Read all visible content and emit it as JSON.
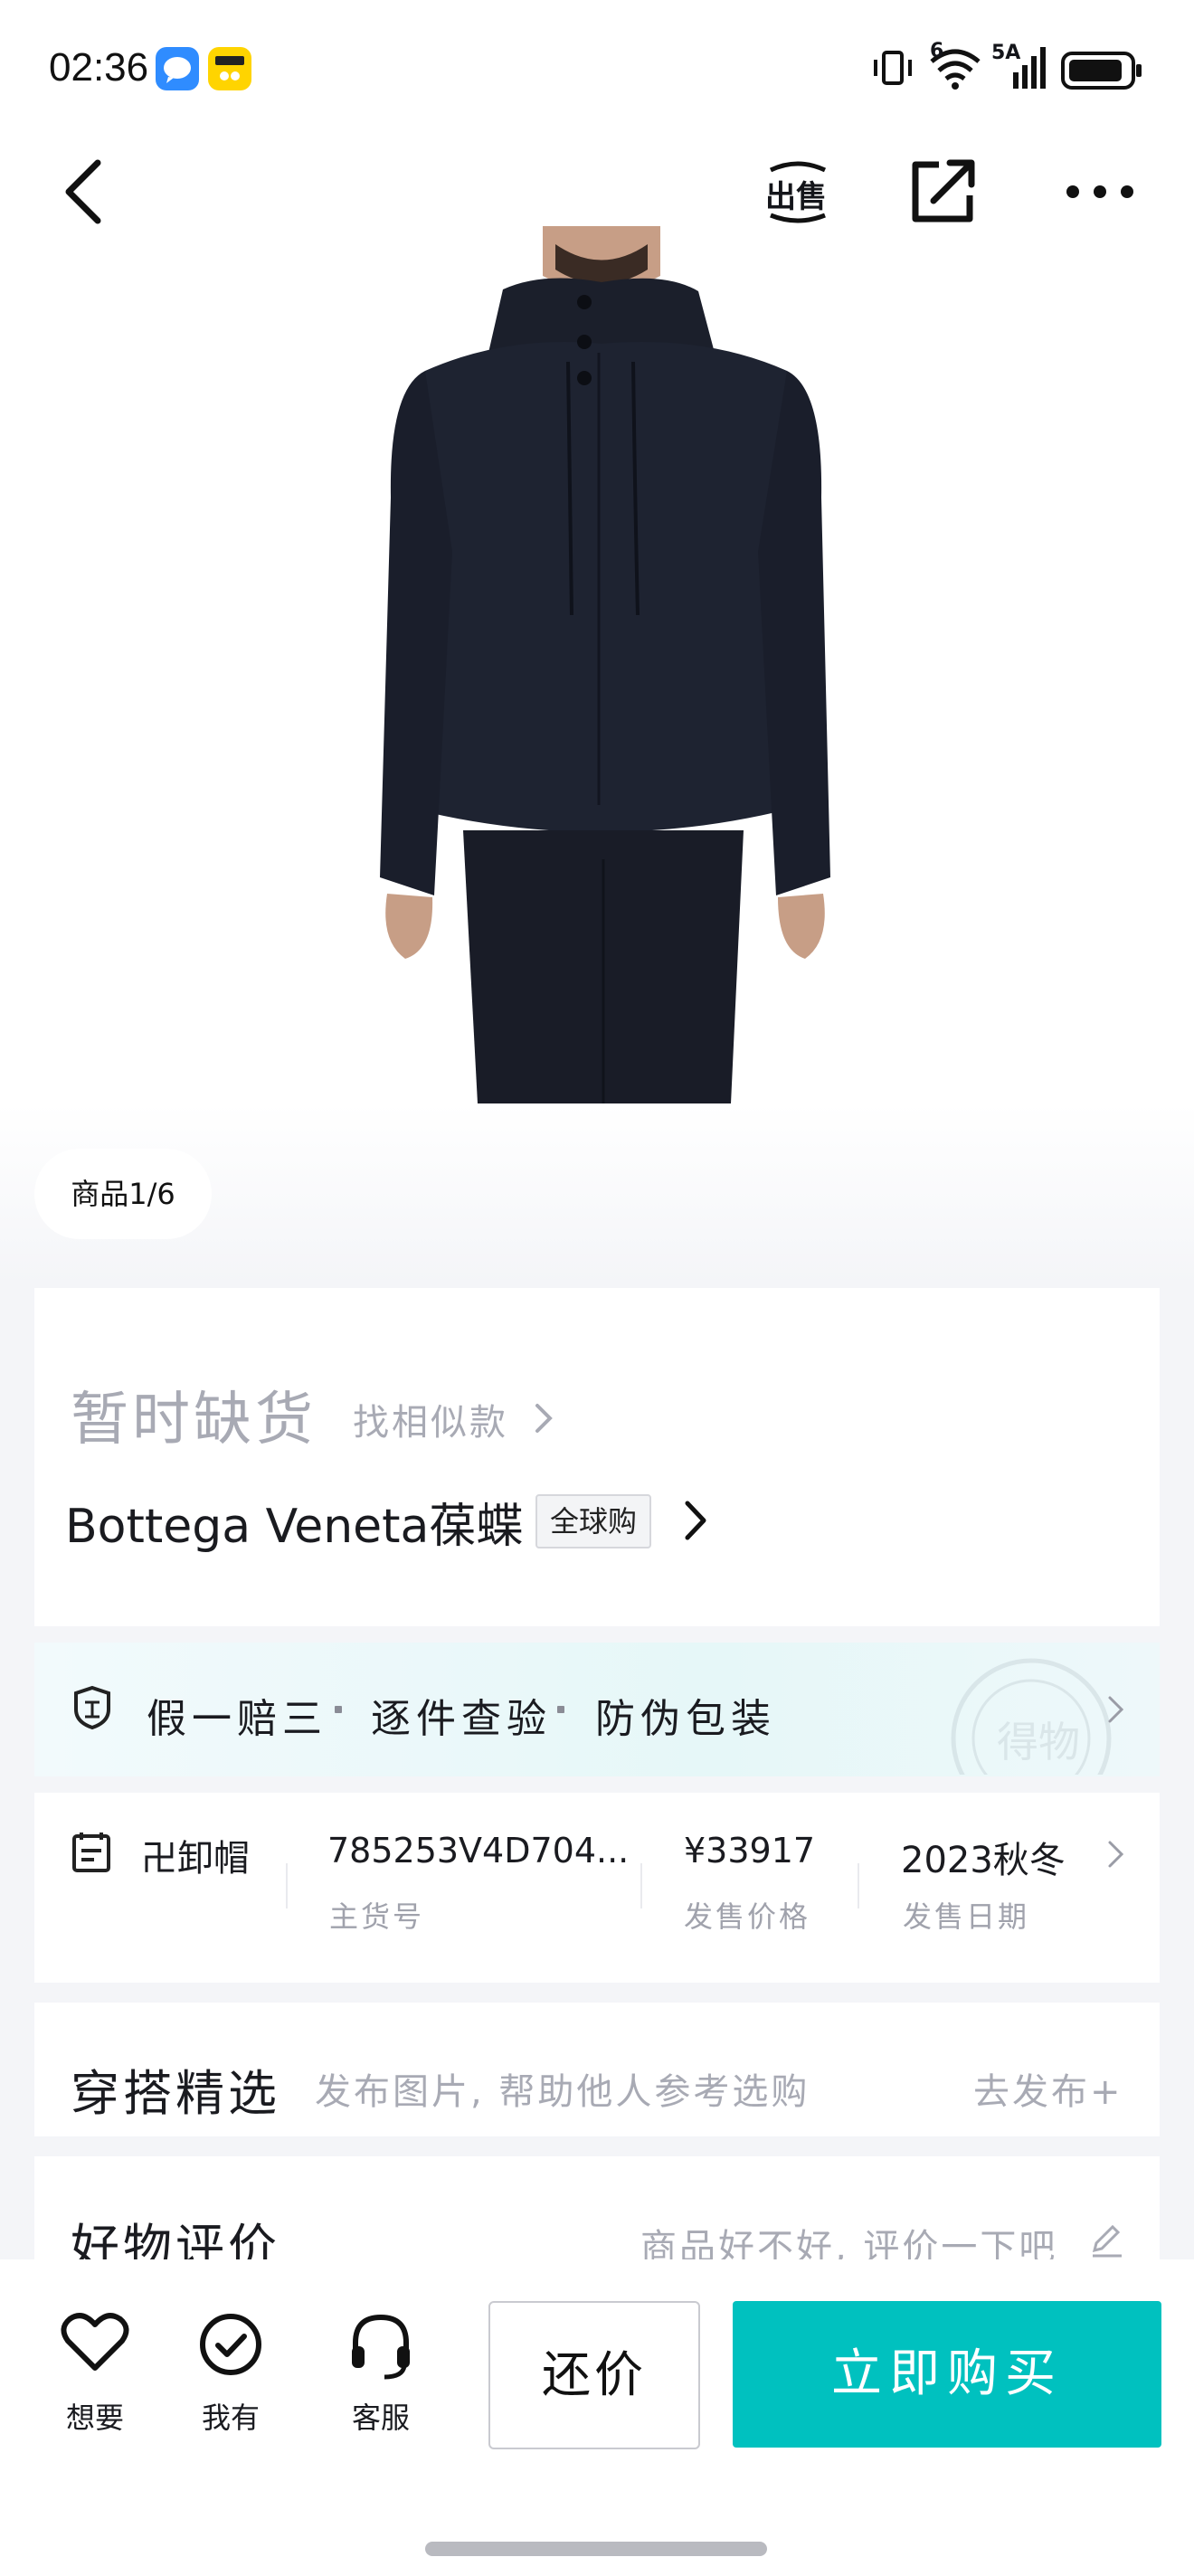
{
  "status_bar": {
    "time": "02:36",
    "network_label": "5A",
    "signal_label": "6",
    "icons": [
      "chat-app-icon",
      "dewu-app-icon",
      "vibrate-icon",
      "wifi-icon",
      "signal-icon",
      "battery-icon"
    ]
  },
  "nav": {
    "icons": [
      "back-icon",
      "sell-icon",
      "share-icon",
      "more-icon"
    ],
    "sell_label": "出售"
  },
  "gallery": {
    "counter": "商品1/6"
  },
  "product": {
    "status": "暂时缺货",
    "find_similar": "找相似款",
    "title": "Bottega Veneta葆蝶",
    "global_badge": "全球购"
  },
  "guarantees": {
    "items": [
      "假一赔三",
      "逐件查验",
      "防伪包装"
    ],
    "icon": "shield-icon",
    "watermark_text": "得物"
  },
  "info": {
    "category": "卍卸帽",
    "sku": "785253V4D704...",
    "sku_label": "主货号",
    "price": "¥33917",
    "price_label": "发售价格",
    "release": "2023秋冬",
    "release_label": "发售日期"
  },
  "outfit": {
    "title": "穿搭精选",
    "hint": "发布图片, 帮助他人参考选购",
    "publish": "去发布+"
  },
  "review": {
    "title": "好物评价",
    "hint": "商品好不好, 评价一下吧"
  },
  "bottom": {
    "want": "想要",
    "have": "我有",
    "service": "客服",
    "counter_offer": "还价",
    "buy_now": "立即购买"
  },
  "colors": {
    "accent": "#00c1bf",
    "muted_text": "#a8aab4",
    "background": "#f4f5f8"
  }
}
